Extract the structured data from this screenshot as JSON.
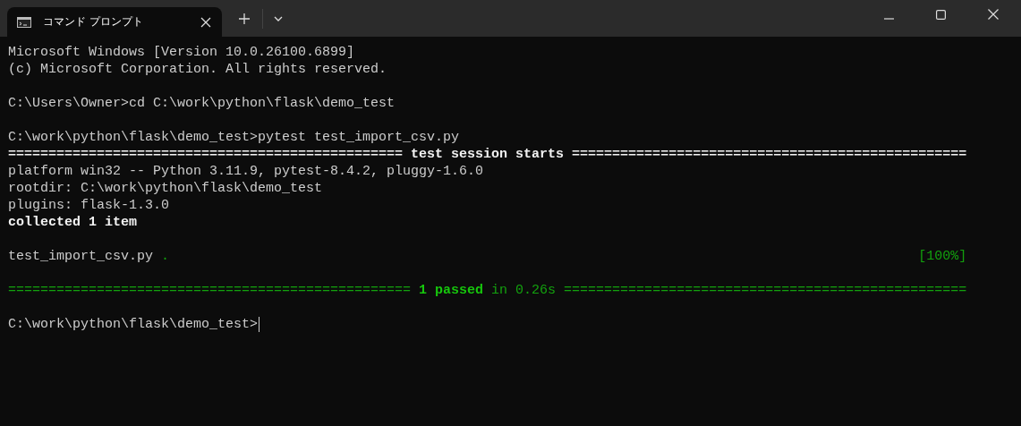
{
  "window": {
    "tab_title": "コマンド プロンプト"
  },
  "terminal": {
    "blocks": [
      {
        "lines": [
          {
            "segments": [
              {
                "text": "Microsoft Windows [Version 10.0.26100.6899]",
                "kind": "normal"
              }
            ]
          },
          {
            "segments": [
              {
                "text": "(c) Microsoft Corporation. All rights reserved.",
                "kind": "normal"
              }
            ]
          }
        ]
      },
      {
        "lines": [
          {
            "segments": [
              {
                "text": "C:\\Users\\Owner>cd C:\\work\\python\\flask\\demo_test",
                "kind": "normal"
              }
            ]
          }
        ]
      },
      {
        "lines": [
          {
            "segments": [
              {
                "text": "C:\\work\\python\\flask\\demo_test>pytest test_import_csv.py",
                "kind": "normal"
              }
            ]
          },
          {
            "segments": [
              {
                "text": "=================================================",
                "kind": "bold"
              },
              {
                "text": " test session starts ",
                "kind": "bold"
              },
              {
                "text": "=================================================",
                "kind": "bold"
              }
            ]
          },
          {
            "segments": [
              {
                "text": "platform win32 -- Python 3.11.9, pytest-8.4.2, pluggy-1.6.0",
                "kind": "normal"
              }
            ]
          },
          {
            "segments": [
              {
                "text": "rootdir: C:\\work\\python\\flask\\demo_test",
                "kind": "normal"
              }
            ]
          },
          {
            "segments": [
              {
                "text": "plugins: flask-1.3.0",
                "kind": "normal"
              }
            ]
          },
          {
            "segments": [
              {
                "text": "collected 1 item",
                "kind": "bold"
              }
            ]
          }
        ]
      },
      {
        "lines": [
          {
            "segments": [
              {
                "text": "test_import_csv.py ",
                "kind": "normal"
              },
              {
                "text": ".",
                "kind": "green"
              }
            ],
            "right_segments": [
              {
                "text": "[100%]",
                "kind": "green"
              }
            ]
          }
        ]
      },
      {
        "lines": [
          {
            "segments": [
              {
                "text": "==================================================",
                "kind": "green"
              },
              {
                "text": " 1 passed",
                "kind": "green-bold"
              },
              {
                "text": " in 0.26s ",
                "kind": "green"
              },
              {
                "text": "==================================================",
                "kind": "green"
              }
            ]
          }
        ]
      },
      {
        "lines": [
          {
            "segments": [
              {
                "text": "C:\\work\\python\\flask\\demo_test>",
                "kind": "normal"
              }
            ],
            "cursor": true
          }
        ]
      }
    ]
  }
}
